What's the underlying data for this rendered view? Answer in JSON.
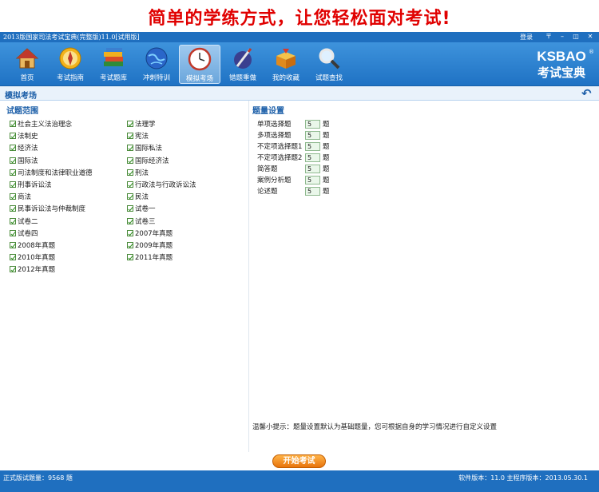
{
  "banner": {
    "text": "简单的学练方式，让您轻松面对考试!"
  },
  "window": {
    "title": "2013版国家司法考试宝典(完整版)11.0[试用版]",
    "login": "登录",
    "controls": [
      "〒",
      "–",
      "◫",
      "✕"
    ]
  },
  "toolbar": {
    "items": [
      {
        "label": "首页",
        "icon": "home-icon"
      },
      {
        "label": "考试指南",
        "icon": "compass-icon"
      },
      {
        "label": "考试题库",
        "icon": "books-icon"
      },
      {
        "label": "冲刺特训",
        "icon": "globe-icon"
      },
      {
        "label": "模拟考场",
        "icon": "clock-icon",
        "active": true
      },
      {
        "label": "错题重做",
        "icon": "pen-icon"
      },
      {
        "label": "我的收藏",
        "icon": "box-icon"
      },
      {
        "label": "试题查找",
        "icon": "magnifier-icon"
      }
    ],
    "logo_top": "KSBAO",
    "logo_bottom": "考试宝典",
    "logo_reg": "®"
  },
  "section": {
    "title": "模拟考场",
    "back_icon": "back-arrow-icon"
  },
  "scope": {
    "heading": "试题范围",
    "left": [
      "社会主义法治理念",
      "法制史",
      "经济法",
      "国际法",
      "司法制度和法律职业道德",
      "刑事诉讼法",
      "商法",
      "民事诉讼法与仲裁制度",
      "试卷二",
      "试卷四",
      "2008年真题",
      "2010年真题",
      "2012年真题"
    ],
    "right": [
      "法理学",
      "宪法",
      "国际私法",
      "国际经济法",
      "刑法",
      "行政法与行政诉讼法",
      "民法",
      "试卷一",
      "试卷三",
      "2007年真题",
      "2009年真题",
      "2011年真题"
    ]
  },
  "quantity": {
    "heading": "题量设置",
    "unit": "题",
    "rows": [
      {
        "name": "单项选择题",
        "value": "5"
      },
      {
        "name": "多项选择题",
        "value": "5"
      },
      {
        "name": "不定项选择题1",
        "value": "5"
      },
      {
        "name": "不定项选择题2",
        "value": "5"
      },
      {
        "name": "简答题",
        "value": "5"
      },
      {
        "name": "案例分析题",
        "value": "5"
      },
      {
        "name": "论述题",
        "value": "5"
      }
    ],
    "tip": "温馨小提示：题量设置默认为基础题量，您可根据自身的学习情况进行自定义设置"
  },
  "start_button": "开始考试",
  "status": {
    "left": "正式版试题量：9568 题",
    "right": "软件版本：11.0 主程序版本：2013.05.30.1"
  },
  "colors": {
    "accent": "#1f6fbf",
    "banner_red": "#e00000",
    "start_orange": "#f08c1c"
  }
}
